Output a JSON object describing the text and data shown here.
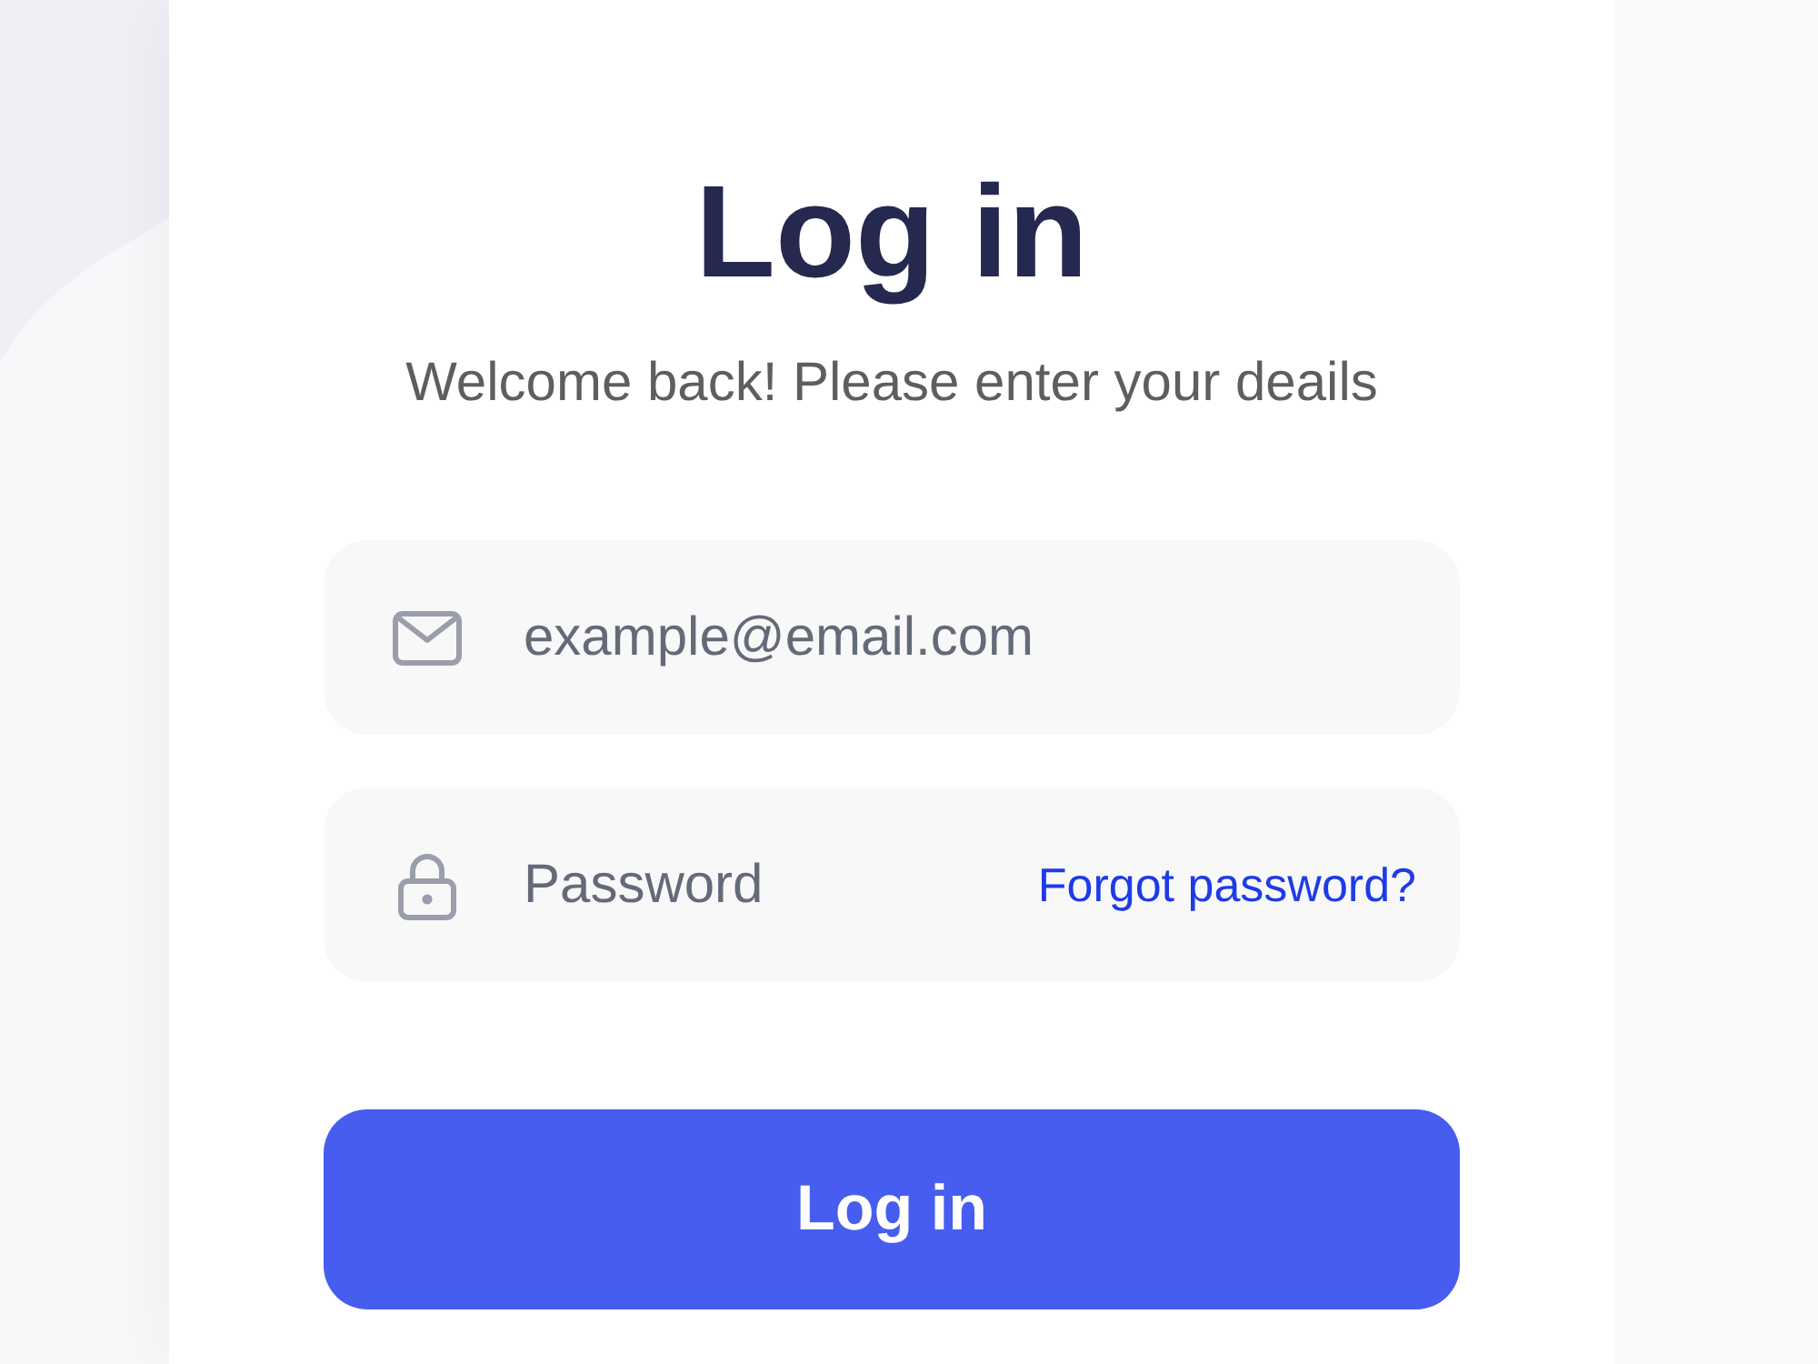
{
  "title": "Log in",
  "subtitle": "Welcome back! Please enter your deails",
  "fields": [
    {
      "kind": "email",
      "placeholder": "example@email.com"
    },
    {
      "kind": "password",
      "placeholder": "Password",
      "link": "Forgot password?"
    }
  ],
  "submit_button": "Log in"
}
